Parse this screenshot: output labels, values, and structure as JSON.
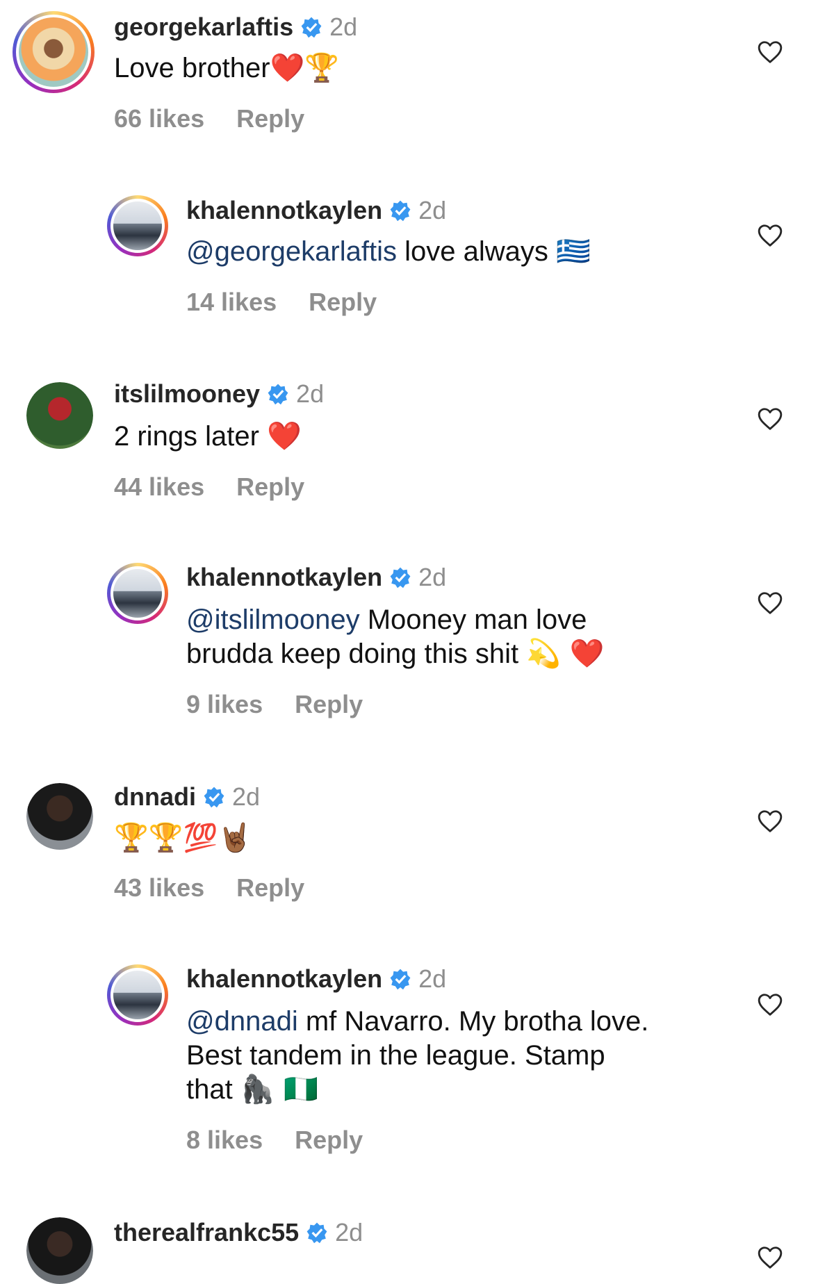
{
  "comments": [
    {
      "username": "georgekarlaftis",
      "time": "2d",
      "mention": "",
      "text": "Love brother",
      "emoji": "❤️🏆",
      "likes": "66 likes",
      "reply": "Reply"
    },
    {
      "username": "khalennotkaylen",
      "time": "2d",
      "mention": "@georgekarlaftis",
      "text": " love always ",
      "emoji": "🇬🇷",
      "likes": "14 likes",
      "reply": "Reply"
    },
    {
      "username": "itslilmooney",
      "time": "2d",
      "mention": "",
      "text": "2 rings later ",
      "emoji": "❤️",
      "likes": "44 likes",
      "reply": "Reply"
    },
    {
      "username": "khalennotkaylen",
      "time": "2d",
      "mention": "@itslilmooney",
      "text": " Mooney man love\nbrudda keep doing this shit ",
      "emoji": "💫 ❤️",
      "likes": "9 likes",
      "reply": "Reply"
    },
    {
      "username": "dnnadi",
      "time": "2d",
      "mention": "",
      "text": "",
      "emoji": "🏆🏆💯🤘🏾",
      "likes": "43 likes",
      "reply": "Reply"
    },
    {
      "username": "khalennotkaylen",
      "time": "2d",
      "mention": "@dnnadi",
      "text": " mf Navarro. My brotha love.\nBest tandem in the league. Stamp\nthat ",
      "emoji": "🦍 🇳🇬",
      "likes": "8 likes",
      "reply": "Reply"
    },
    {
      "username": "therealfrankc55",
      "time": "2d"
    }
  ],
  "colors": {
    "verified": "#3897f0",
    "mention": "#1d3c68",
    "meta": "#8e8e8e"
  },
  "icons": {
    "verified": "verified-badge-icon",
    "like": "heart-outline-icon"
  }
}
